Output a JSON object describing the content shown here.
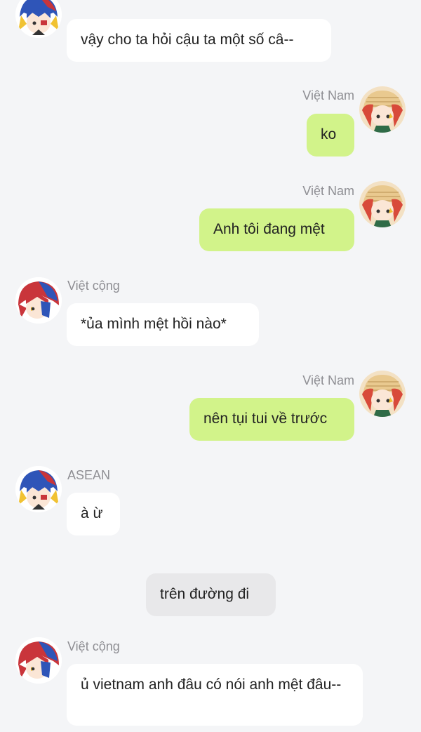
{
  "chat": {
    "messages": [
      {
        "sender": "ASEAN",
        "text": "vậy cho ta hỏi cậu ta một số câ--"
      },
      {
        "sender": "Việt Nam",
        "text": "ko"
      },
      {
        "sender": "Việt Nam",
        "text": "Anh tôi đang mệt"
      },
      {
        "sender": "Việt cộng",
        "text": "*ủa mình mệt hồi nào*"
      },
      {
        "sender": "Việt Nam",
        "text": "nên tụi tui về trước"
      },
      {
        "sender": "ASEAN",
        "text": "à ừ"
      },
      {
        "sender": "",
        "text": "trên đường đi"
      },
      {
        "sender": "Việt cộng",
        "text": "ủ vietnam anh đâu có nói anh mệt đâu--"
      }
    ]
  },
  "colors": {
    "background": "#f4f5f7",
    "bubble_incoming": "#ffffff",
    "bubble_outgoing": "#d2f38a",
    "bubble_narration": "#e8e8ea",
    "name_text": "#8e8e93"
  },
  "icons": {
    "asean_avatar": "asean-avatar-icon",
    "vietnam_avatar": "vietnam-avatar-icon",
    "vietcong_avatar": "vietcong-avatar-icon"
  }
}
